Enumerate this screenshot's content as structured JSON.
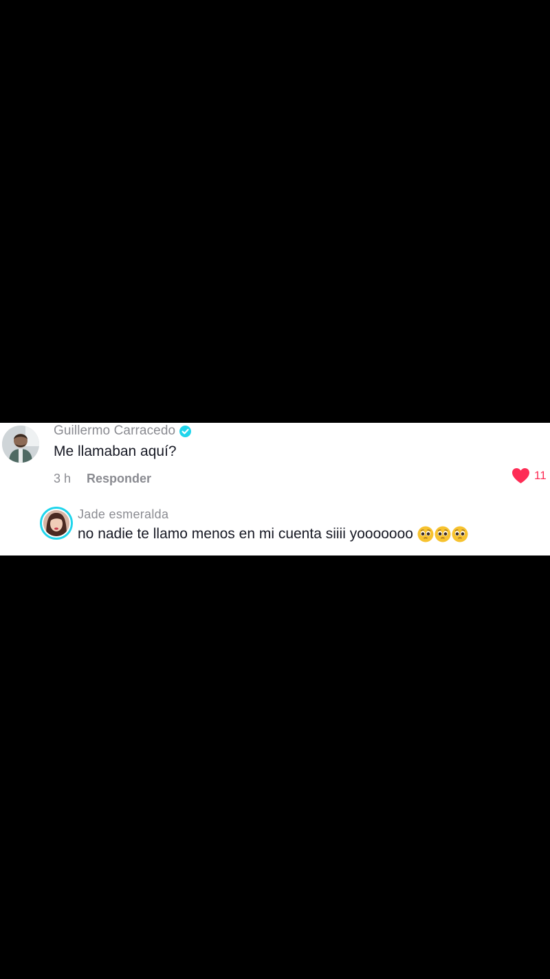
{
  "comment": {
    "author": "Guillermo Carracedo",
    "verified": true,
    "text": "Me llamaban aquí?",
    "timestamp": "3 h",
    "reply_label": "Responder",
    "like_count": "11",
    "avatar_icon": "person-photo-avatar",
    "verified_icon": "verified-badge-icon",
    "like_icon": "heart-icon"
  },
  "reply": {
    "author": "Jade esmeralda",
    "text": "no nadie te llamo menos en mi cuenta siiii yooooooo",
    "emoji": [
      "pleading-face-icon",
      "pleading-face-icon",
      "pleading-face-icon"
    ],
    "avatar_icon": "person-photo-avatar"
  },
  "colors": {
    "background": "#000000",
    "card": "#ffffff",
    "muted_text": "#8a8b91",
    "primary_text": "#161823",
    "like": "#fe2c55",
    "verified": "#20d5ec",
    "story_ring": "#20d5ec"
  }
}
